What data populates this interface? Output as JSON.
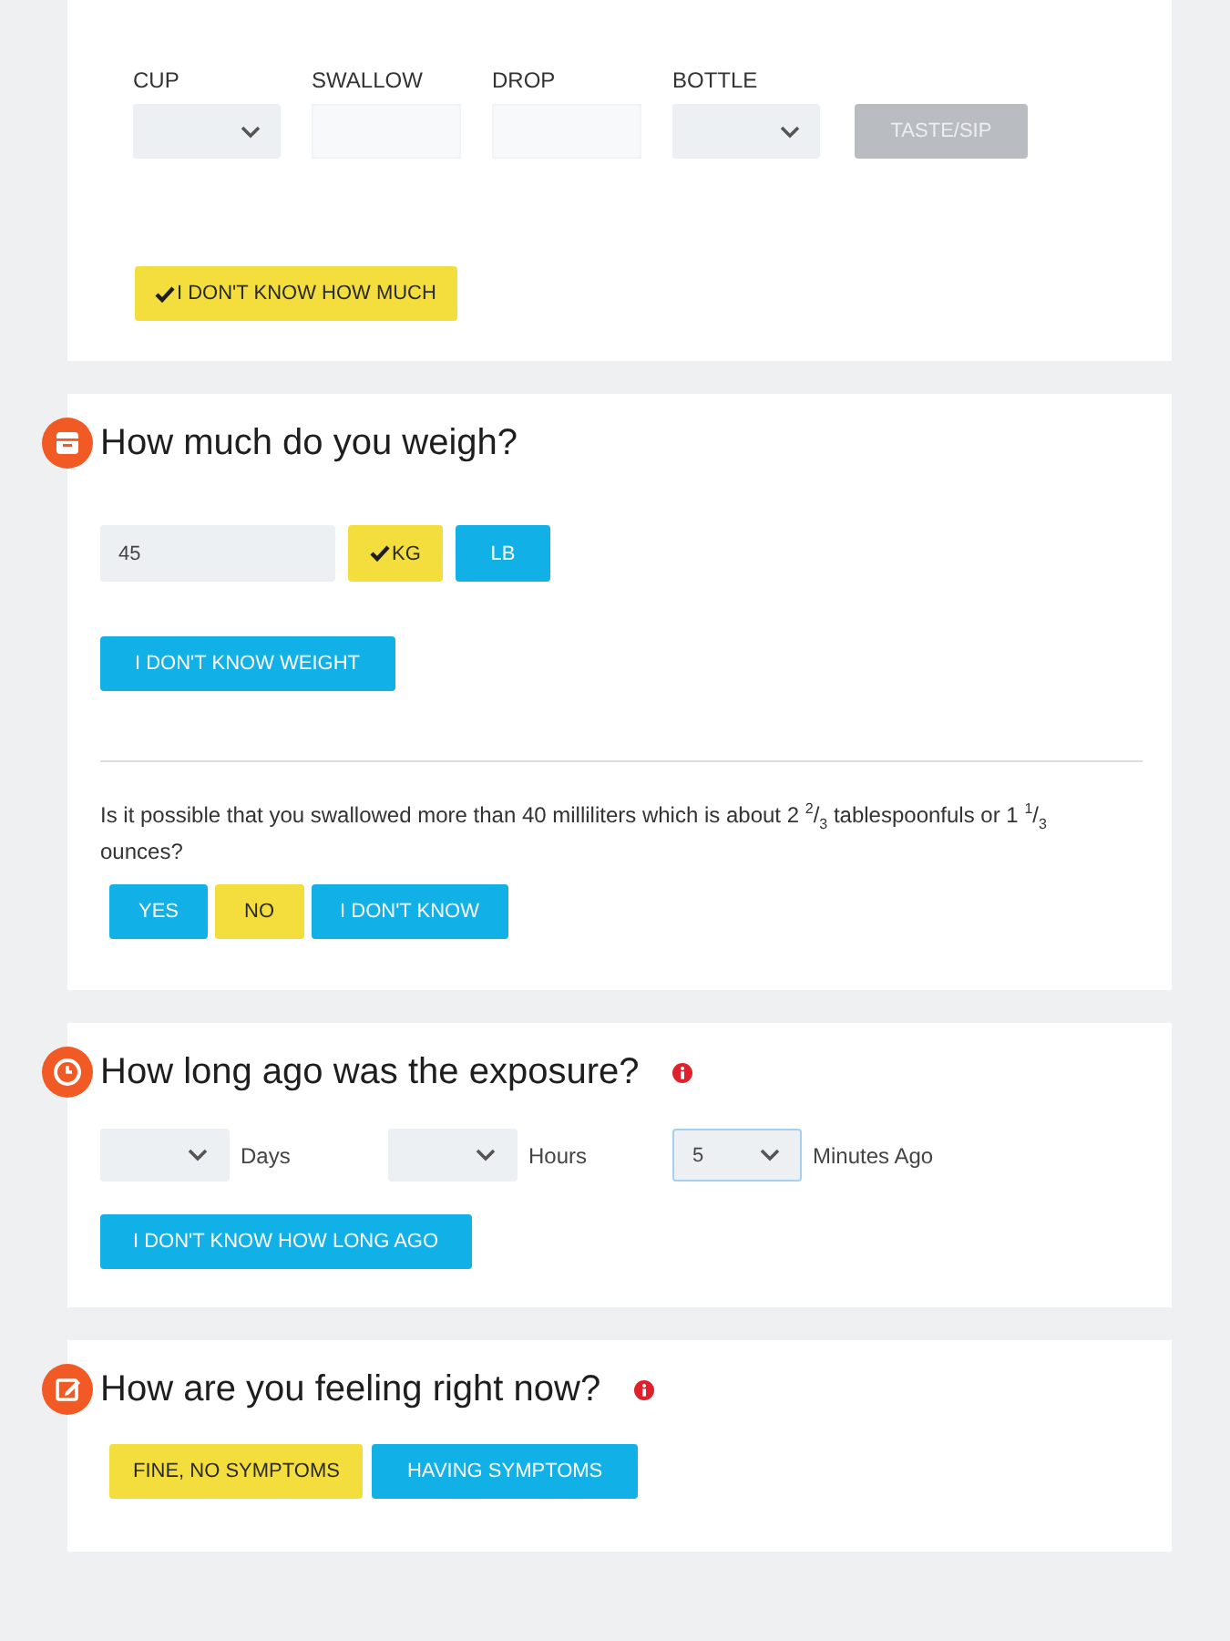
{
  "amount_section": {
    "fields": [
      {
        "kind": "select",
        "label": "CUP"
      },
      {
        "kind": "input",
        "label": "SWALLOW"
      },
      {
        "kind": "input",
        "label": "DROP"
      },
      {
        "kind": "select",
        "label": "BOTTLE"
      }
    ],
    "taste_button": {
      "label": "TASTE/SIP",
      "disabled": true
    },
    "unknown_button": {
      "label": "I DON'T KNOW HOW MUCH",
      "selected": true,
      "checked": true
    }
  },
  "weight_section": {
    "title": "How much do you weigh?",
    "weight_field": {
      "value": "45"
    },
    "units": [
      {
        "label": "KG",
        "selected": true,
        "checked": true
      },
      {
        "label": "LB",
        "selected": false,
        "checked": false
      }
    ],
    "unknown_button": {
      "label": "I DON'T KNOW WEIGHT",
      "selected": false
    },
    "question": "Is it possible that you swallowed more than 40 milliliters which is about 2 $^{2}$/$_{3}$ tablespoonfuls or 1 $^{1}$/$_{3}$ ounces?",
    "answers": [
      {
        "label": "YES",
        "selected": false
      },
      {
        "label": "NO",
        "selected": true
      },
      {
        "label": "I DON'T KNOW",
        "selected": false
      }
    ]
  },
  "exposure_section": {
    "title": "How long ago was the exposure?",
    "time_fields": [
      {
        "unit": "Days",
        "focused": false
      },
      {
        "unit": "Hours",
        "focused": false
      },
      {
        "value": "5",
        "unit": "Minutes Ago",
        "focused": true
      }
    ],
    "unknown_button": {
      "label": "I DON'T KNOW HOW LONG AGO",
      "selected": false
    }
  },
  "feeling_section": {
    "title": "How are you feeling right now?",
    "options": [
      {
        "label": "FINE, NO SYMPTOMS",
        "selected": true
      },
      {
        "label": "HAVING SYMPTOMS",
        "selected": false
      }
    ]
  }
}
